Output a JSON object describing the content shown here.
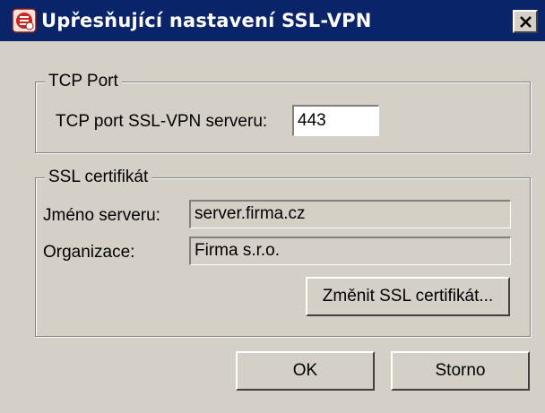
{
  "window": {
    "title": "Upřesňující nastavení SSL-VPN",
    "title_icon": "kerio-control-icon",
    "close_icon": "close-icon"
  },
  "tcp_port_group": {
    "legend": "TCP Port",
    "port_label": "TCP port SSL-VPN serveru:",
    "port_value": "443"
  },
  "ssl_group": {
    "legend": "SSL certifikát",
    "server_name_label": "Jméno serveru:",
    "server_name_value": "server.firma.cz",
    "organization_label": "Organizace:",
    "organization_value": "Firma s.r.o.",
    "change_cert_button": "Změnit SSL certifikát..."
  },
  "buttons": {
    "ok": "OK",
    "cancel": "Storno"
  },
  "colors": {
    "titlebar": "#0a246a",
    "dialog_bg": "#d4d0c8",
    "input_bg": "#ffffff"
  }
}
